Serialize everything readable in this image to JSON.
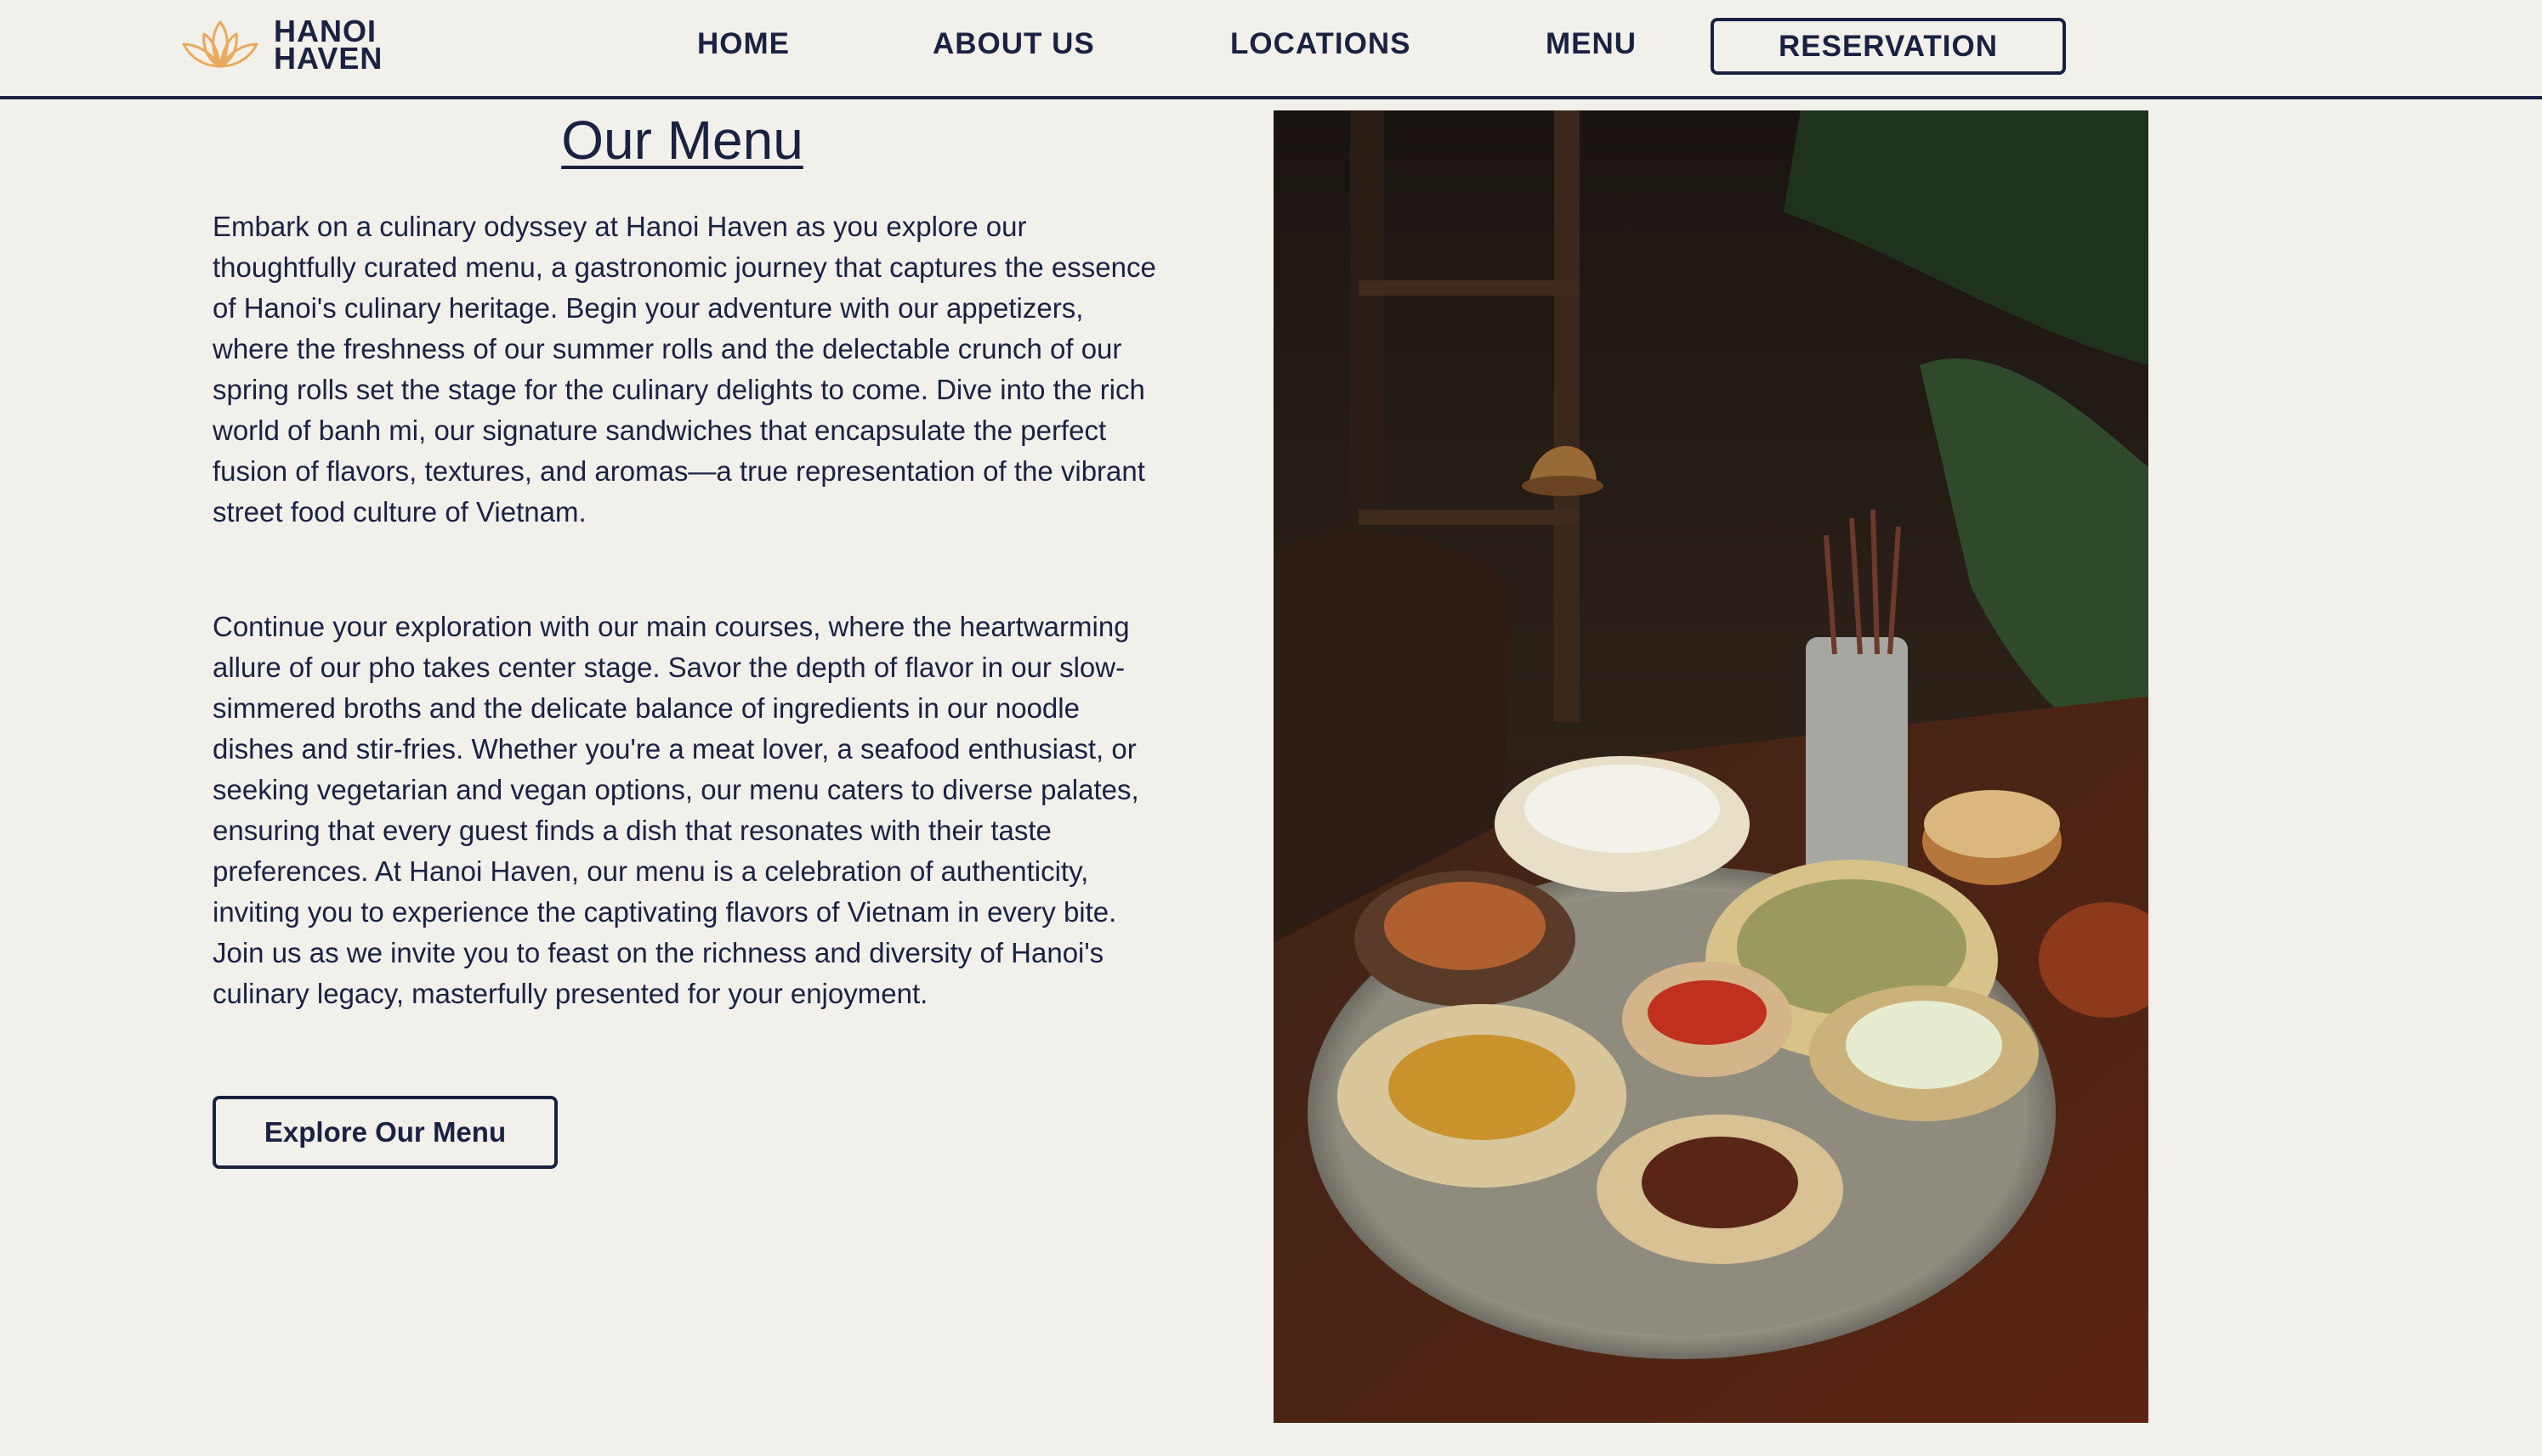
{
  "brand": {
    "name_line1": "HANOI",
    "name_line2": "HAVEN",
    "logo_icon": "lotus-icon",
    "accent_color": "#e9a95a"
  },
  "nav": {
    "home": "HOME",
    "about": "ABOUT US",
    "locations": "LOCATIONS",
    "menu": "MENU",
    "reservation": "RESERVATION"
  },
  "main": {
    "title": "Our Menu",
    "paragraph1": "Embark on a culinary odyssey at Hanoi Haven as you explore our thoughtfully curated menu, a gastronomic journey that captures the essence of Hanoi's culinary heritage. Begin your adventure with our appetizers, where the freshness of our summer rolls and the delectable crunch of our spring rolls set the stage for the culinary delights to come. Dive into the rich world of banh mi, our signature sandwiches that encapsulate the perfect fusion of flavors, textures, and aromas—a true representation of the vibrant street food culture of Vietnam.",
    "paragraph2": "Continue your exploration with our main courses, where the heartwarming allure of our pho takes center stage. Savor the depth of flavor in our slow-simmered broths and the delicate balance of ingredients in our noodle dishes and stir-fries. Whether you're a meat lover, a seafood enthusiast, or seeking vegetarian and vegan options, our menu caters to diverse palates, ensuring that every guest finds a dish that resonates with their taste preferences. At Hanoi Haven, our menu is a celebration of authenticity, inviting you to experience the captivating flavors of Vietnam in every bite. Join us as we invite you to feast on the richness and diversity of Hanoi's culinary legacy, masterfully presented for your enjoyment.",
    "cta": "Explore Our Menu"
  },
  "colors": {
    "navy": "#1b2142",
    "background": "#f1f0eb"
  }
}
